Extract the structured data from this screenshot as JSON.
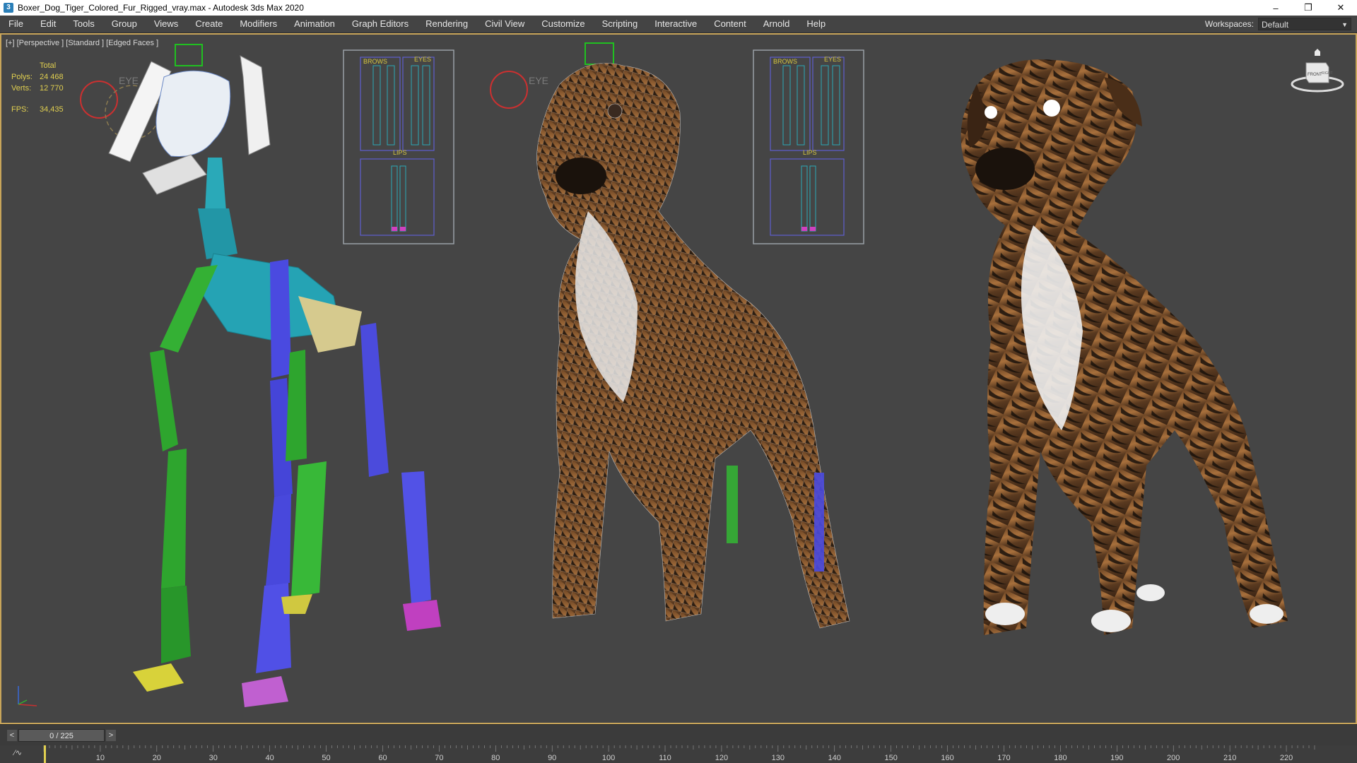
{
  "window": {
    "title": "Boxer_Dog_Tiger_Colored_Fur_Rigged_vray.max - Autodesk 3ds Max 2020",
    "app_icon": "3",
    "minimize": "–",
    "restore": "❐",
    "close": "✕"
  },
  "menu": {
    "items": [
      "File",
      "Edit",
      "Tools",
      "Group",
      "Views",
      "Create",
      "Modifiers",
      "Animation",
      "Graph Editors",
      "Rendering",
      "Civil View",
      "Customize",
      "Scripting",
      "Interactive",
      "Content",
      "Arnold",
      "Help"
    ],
    "workspaces_label": "Workspaces:",
    "workspace_value": "Default"
  },
  "viewport": {
    "label": "[+] [Perspective ] [Standard ] [Edged Faces ]",
    "stats": {
      "total_label": "Total",
      "polys_label": "Polys:",
      "polys_value": "24 468",
      "verts_label": "Verts:",
      "verts_value": "12 770",
      "fps_label": "FPS:",
      "fps_value": "34,435"
    },
    "panel_labels": {
      "brows": "BROWS",
      "eyes": "EYES",
      "lips": "LIPS",
      "eye_ctrl": "EYE"
    },
    "viewcube_labels": {
      "front": "FRONT",
      "right": "RIGHT"
    },
    "accent_color": "#c8a55a",
    "stats_color": "#e0cf50"
  },
  "timeslider": {
    "prev": "<",
    "next": ">",
    "current": "0 / 225",
    "total_frames": 225,
    "current_frame": 0
  },
  "trackbar": {
    "ticks": [
      "10",
      "20",
      "30",
      "40",
      "50",
      "60",
      "70",
      "80",
      "90",
      "100",
      "110",
      "120",
      "130",
      "140",
      "150",
      "160",
      "170",
      "180",
      "190",
      "200",
      "210",
      "220"
    ]
  }
}
